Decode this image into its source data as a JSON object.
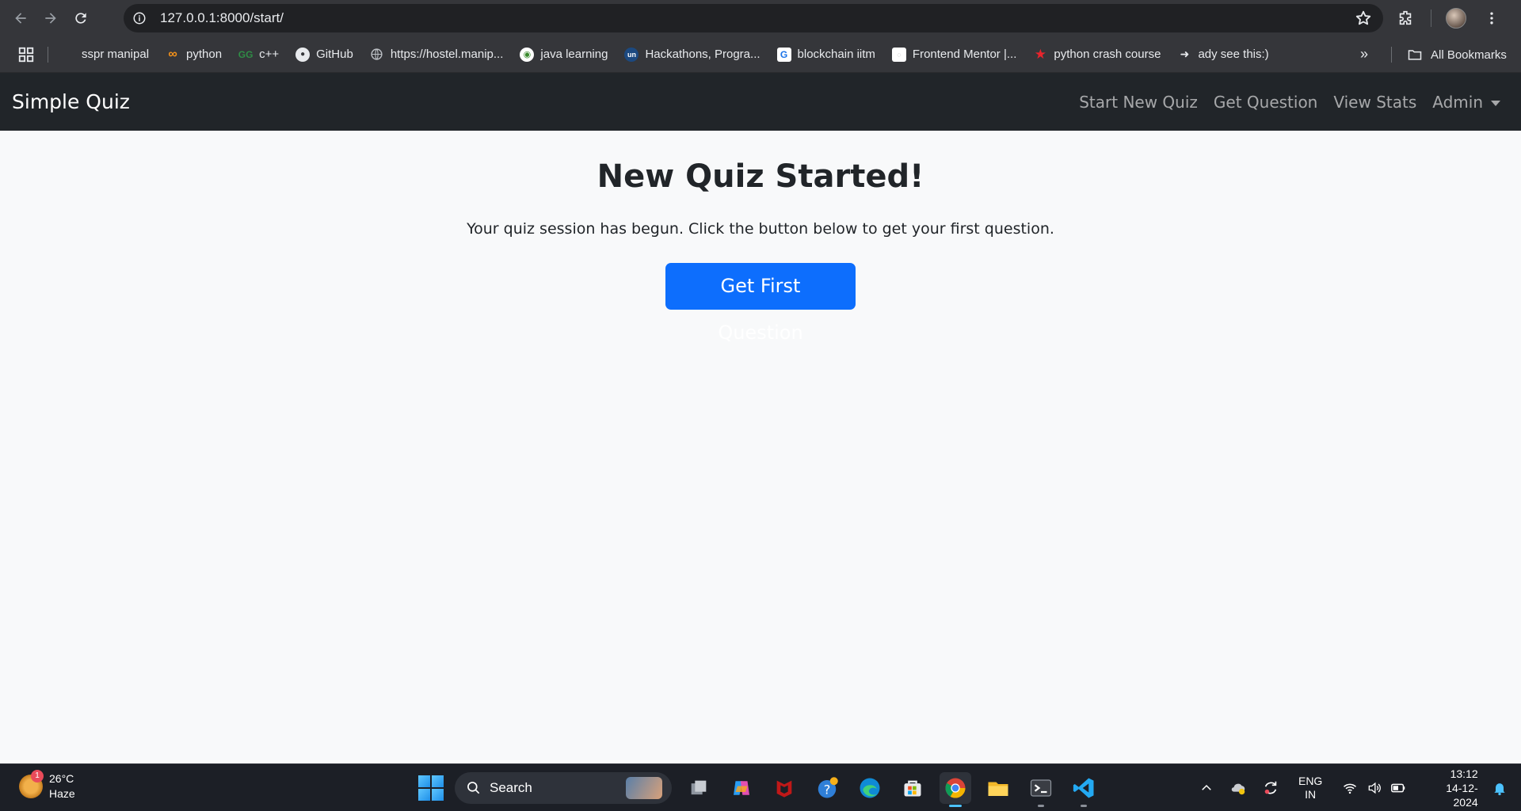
{
  "browser": {
    "url": "127.0.0.1:8000/start/",
    "bookmarks": [
      {
        "label": "sspr manipal",
        "icon": "microsoft-icon"
      },
      {
        "label": "python",
        "icon": "coding-ninjas-icon"
      },
      {
        "label": "c++",
        "icon": "gfg-icon"
      },
      {
        "label": "GitHub",
        "icon": "github-icon"
      },
      {
        "label": "https://hostel.manip...",
        "icon": "globe-icon"
      },
      {
        "label": "java learning",
        "icon": "java-icon"
      },
      {
        "label": "Hackathons, Progra...",
        "icon": "unstop-icon"
      },
      {
        "label": "blockchain iitm",
        "icon": "google-icon"
      },
      {
        "label": "Frontend Mentor |...",
        "icon": "frontend-mentor-icon"
      },
      {
        "label": "python crash course",
        "icon": "star-icon"
      },
      {
        "label": "ady see this:)",
        "icon": "arrow-icon"
      }
    ],
    "all_bookmarks_label": "All Bookmarks"
  },
  "site": {
    "brand": "Simple Quiz",
    "nav": {
      "start": "Start New Quiz",
      "get": "Get Question",
      "stats": "View Stats",
      "admin": "Admin"
    }
  },
  "main": {
    "title": "New Quiz Started!",
    "description": "Your quiz session has begun. Click the button below to get your first question.",
    "button": "Get First Question"
  },
  "taskbar": {
    "weather_temp": "26°C",
    "weather_desc": "Haze",
    "weather_badge": "1",
    "search_label": "Search",
    "lang_top": "ENG",
    "lang_bottom": "IN",
    "time": "13:12",
    "date": "14-12-2024"
  },
  "colors": {
    "primary": "#0d6efd",
    "navbar": "#212529",
    "page_bg": "#f8f9fa"
  }
}
